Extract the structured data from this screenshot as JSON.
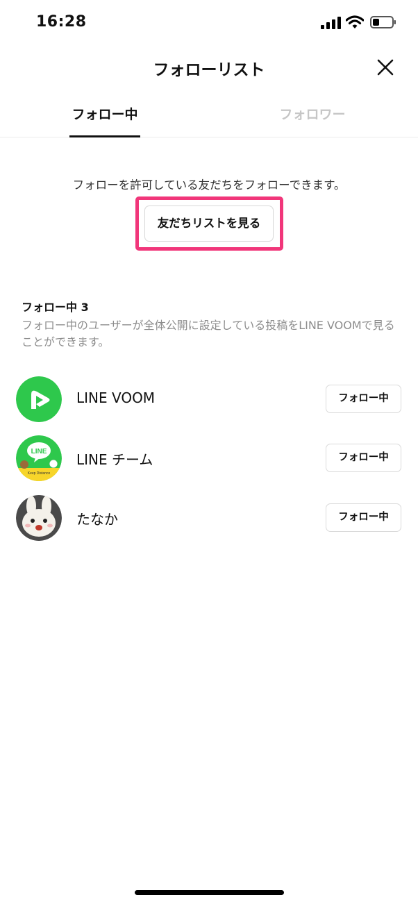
{
  "status_bar": {
    "time": "16:28"
  },
  "header": {
    "title": "フォローリスト"
  },
  "tabs": [
    {
      "label": "フォロー中",
      "active": true
    },
    {
      "label": "フォロワー",
      "active": false
    }
  ],
  "info": {
    "message": "フォローを許可している友だちをフォローできます。",
    "friends_list_button": "友だちリストを見る",
    "highlight_color": "#f1367a"
  },
  "section": {
    "title": "フォロー中 3",
    "description": "フォロー中のユーザーが全体公開に設定している投稿をLINE VOOMで見ることができます。"
  },
  "following": [
    {
      "name": "LINE VOOM",
      "avatar": "line-voom-logo",
      "button": "フォロー中"
    },
    {
      "name": "LINE チーム",
      "avatar": "line-team-logo",
      "button": "フォロー中",
      "avatar_text": {
        "logo": "LINE",
        "caption": "Keep Distance"
      }
    },
    {
      "name": "たなか",
      "avatar": "cony-plush-photo",
      "button": "フォロー中"
    }
  ],
  "colors": {
    "line_green": "#2ec84c",
    "accent_pink": "#f1367a"
  }
}
